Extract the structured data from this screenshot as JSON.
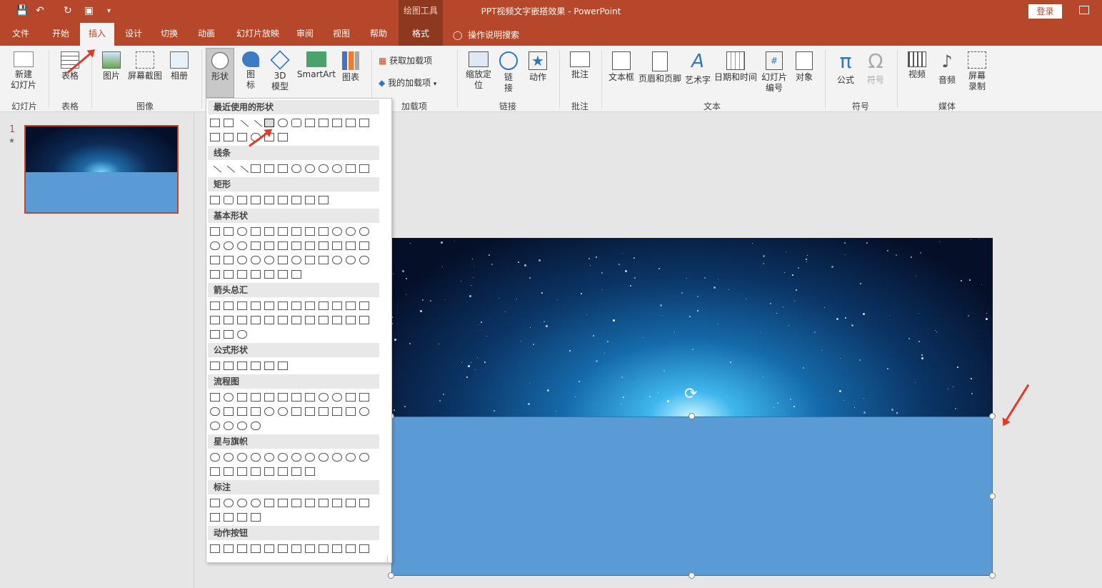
{
  "window": {
    "title": "PPT视频文字嵌搭效果  -  PowerPoint",
    "context_tab": "绘图工具",
    "login": "登录"
  },
  "quick_access": [
    "save-icon",
    "undo-icon",
    "redo-icon",
    "present-icon",
    "dropdown-icon"
  ],
  "tabs": [
    "文件",
    "开始",
    "插入",
    "设计",
    "切换",
    "动画",
    "幻灯片放映",
    "审阅",
    "视图",
    "帮助",
    "格式"
  ],
  "tell_me": "操作说明搜索",
  "ribbon": {
    "new_slide": "新建\n幻灯片",
    "table": "表格",
    "picture": "图片",
    "screenshot": "屏幕截图",
    "album": "相册",
    "shapes": "形状",
    "icons": "图\n标",
    "model3d": "3D\n模型",
    "smartart": "SmartArt",
    "chart": "图表",
    "get_addins": "获取加载项",
    "my_addins": "我的加载项",
    "zoom": "缩放定\n位",
    "link": "链\n接",
    "action": "动作",
    "comment": "批注",
    "textbox": "文本框",
    "header_footer": "页眉和页脚",
    "wordart": "艺术字",
    "datetime": "日期和时间",
    "slide_number": "幻灯片\n编号",
    "object": "对象",
    "equation": "公式",
    "symbol": "符号",
    "video": "视频",
    "audio": "音频",
    "screen_rec": "屏幕\n录制",
    "groups": {
      "slides": "幻灯片",
      "tables": "表格",
      "images": "图像",
      "addins": "加载项",
      "links": "链接",
      "comments": "批注",
      "text": "文本",
      "symbols": "符号",
      "media": "媒体"
    }
  },
  "shapes_menu": {
    "categories": [
      "最近使用的形状",
      "线条",
      "矩形",
      "基本形状",
      "箭头总汇",
      "公式形状",
      "流程图",
      "星与旗帜",
      "标注",
      "动作按钮"
    ]
  },
  "slide_panel": {
    "slide_number": "1",
    "star": "★"
  },
  "colors": {
    "accent": "#b7472a",
    "shape_fill": "#5b9bd5",
    "arrow": "#e03a2a"
  }
}
